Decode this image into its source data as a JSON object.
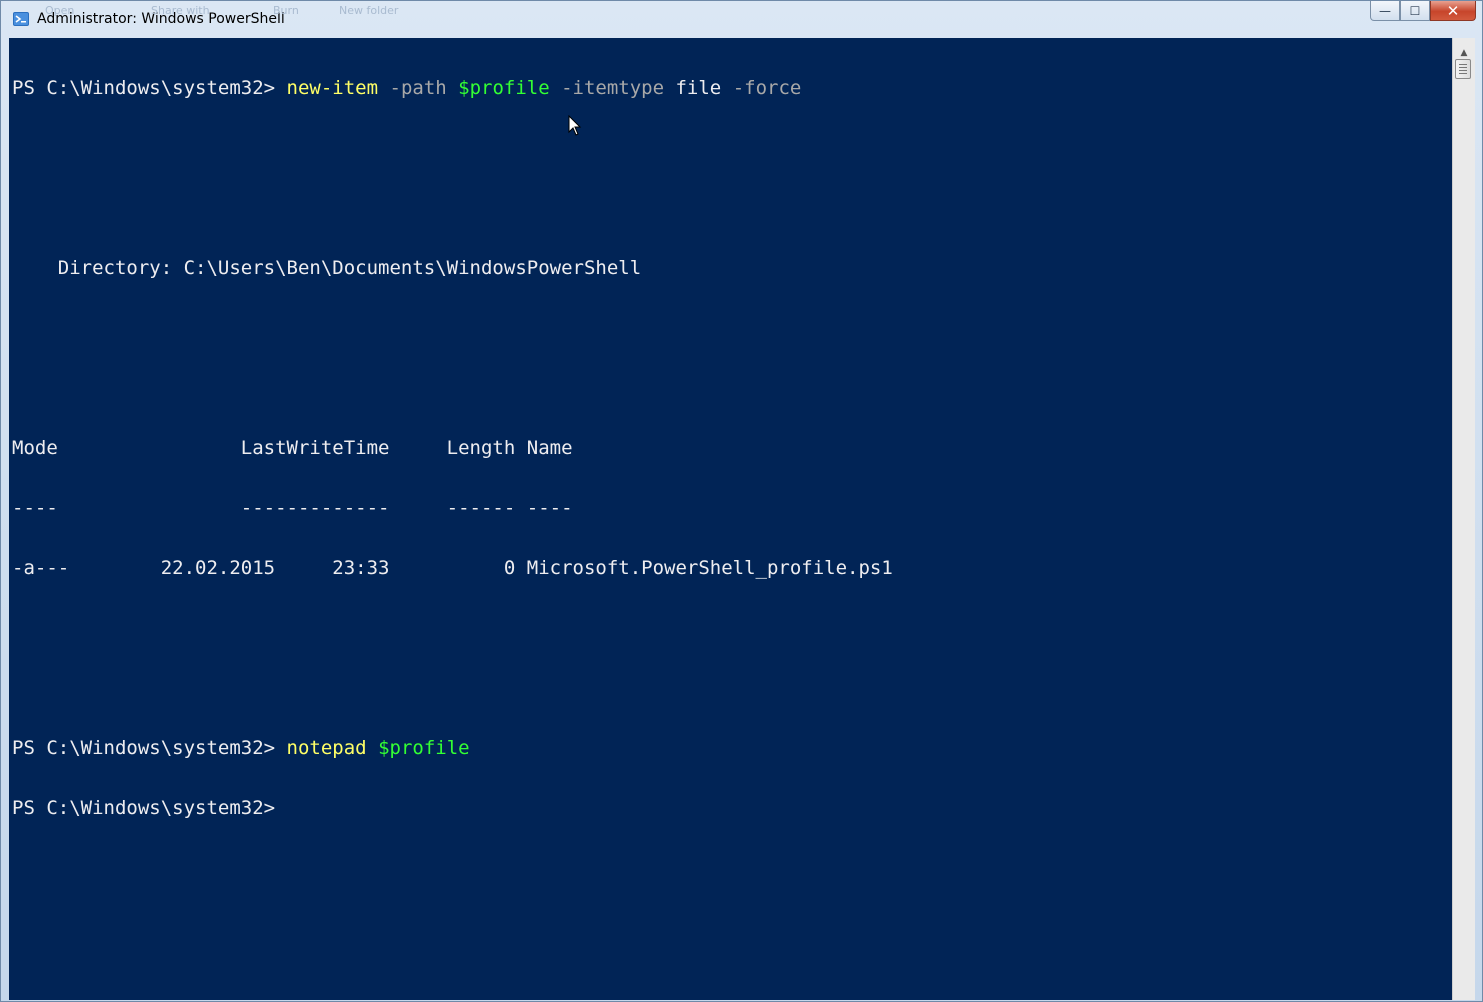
{
  "window": {
    "title": "Administrator: Windows PowerShell",
    "ghost_texts": [
      "Open",
      "Share with",
      "Burn",
      "New folder"
    ]
  },
  "caption": {
    "minimize": "—",
    "maximize": "☐",
    "close": "✕"
  },
  "colors": {
    "console_background": "#012456",
    "command": "#ffff66",
    "parameter": "#a8a8a8",
    "variable": "#33ff33",
    "text": "#eeedf0"
  },
  "console": {
    "line1": {
      "prompt": "PS C:\\Windows\\system32> ",
      "cmd": "new-item",
      "p1": " -path",
      "v1": " $profile",
      "p2": " -itemtype",
      "arg": " file",
      "p3": " -force"
    },
    "directory_line": "    Directory: C:\\Users\\Ben\\Documents\\WindowsPowerShell",
    "table": {
      "header": "Mode                LastWriteTime     Length Name",
      "separator": "----                -------------     ------ ----",
      "rows": [
        "-a---        22.02.2015     23:33          0 Microsoft.PowerShell_profile.ps1"
      ]
    },
    "line2": {
      "prompt": "PS C:\\Windows\\system32> ",
      "cmd": "notepad",
      "v1": " $profile"
    },
    "line3": {
      "prompt": "PS C:\\Windows\\system32>"
    }
  }
}
